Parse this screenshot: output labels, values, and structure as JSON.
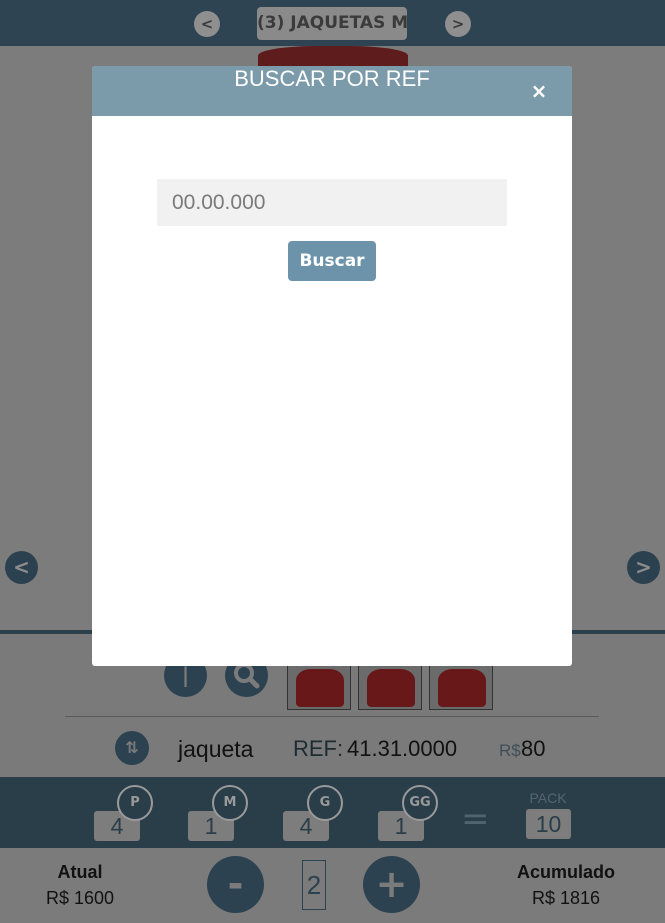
{
  "header": {
    "prev_icon": "chevron-left",
    "next_icon": "chevron-right",
    "category_title": "(3) JAQUETAS M"
  },
  "product": {
    "name": "jaqueta",
    "ref_label": "REF:",
    "ref_value": "41.31.0000",
    "currency": "R$",
    "price": "80"
  },
  "sizes": [
    {
      "label": "P",
      "qty": "4"
    },
    {
      "label": "M",
      "qty": "1"
    },
    {
      "label": "G",
      "qty": "4"
    },
    {
      "label": "GG",
      "qty": "1"
    }
  ],
  "pack": {
    "label": "PACK",
    "qty": "10"
  },
  "totals": {
    "current_label": "Atual",
    "current_value": "R$ 1600",
    "accum_label": "Acumulado",
    "accum_value": "R$ 1816",
    "counter": "2"
  },
  "modal": {
    "title": "BUSCAR POR REF",
    "close_label": "×",
    "input_placeholder": "00.00.000",
    "input_value": "",
    "search_label": "Buscar"
  },
  "colors": {
    "accent": "#6c93a9",
    "modal_header": "#7b9aaa",
    "dark_bar": "#2a3e4a"
  }
}
